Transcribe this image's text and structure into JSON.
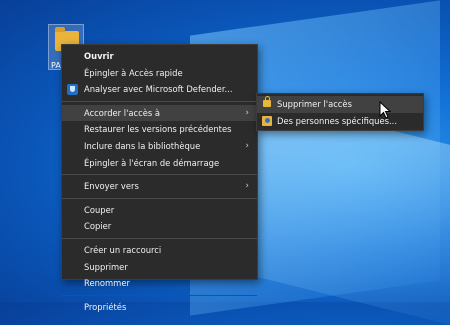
{
  "desktop": {
    "folder_label": "PA"
  },
  "context_menu": {
    "items": [
      {
        "label": "Ouvrir"
      },
      {
        "label": "Épingler à Accès rapide"
      },
      {
        "label": "Analyser avec Microsoft Defender..."
      },
      {
        "label": "Accorder l'accès à"
      },
      {
        "label": "Restaurer les versions précédentes"
      },
      {
        "label": "Inclure dans la bibliothèque"
      },
      {
        "label": "Épingler à l'écran de démarrage"
      },
      {
        "label": "Envoyer vers"
      },
      {
        "label": "Couper"
      },
      {
        "label": "Copier"
      },
      {
        "label": "Créer un raccourci"
      },
      {
        "label": "Supprimer"
      },
      {
        "label": "Renommer"
      },
      {
        "label": "Propriétés"
      }
    ],
    "submenu_arrow": "›"
  },
  "submenu": {
    "items": [
      {
        "label": "Supprimer l'accès",
        "icon": "lock-icon"
      },
      {
        "label": "Des personnes spécifiques...",
        "icon": "people-icon"
      }
    ]
  },
  "colors": {
    "menu_bg": "#2b2b2b",
    "highlight": "#414141",
    "desktop_accent": "#1270d6"
  }
}
